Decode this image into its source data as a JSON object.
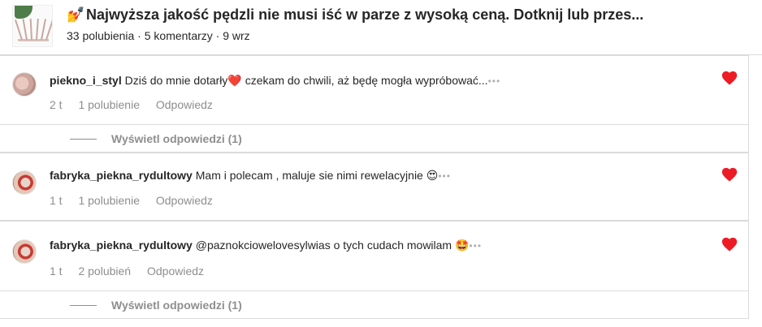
{
  "post": {
    "title": "Najwyższa jakość pędzli nie musi iść w parze z wysoką ceną. Dotknij lub przes...",
    "title_emoji": "💅",
    "meta": "33 polubienia · 5 komentarzy · 9 wrz"
  },
  "comments": [
    {
      "username": "piekno_i_styl",
      "text_before": "Dziś do mnie dotarły",
      "emoji": "❤️",
      "text_after": " czekam do chwili, aż będę mogła wypróbować...",
      "time": "2 t",
      "likes": "1 polubienie",
      "reply": "Odpowiedz",
      "more": "•••"
    },
    {
      "username": "fabryka_piekna_rydultowy",
      "text": "Mam i polecam , maluje sie nimi rewelacyjnie",
      "emoji": "😍",
      "time": "1 t",
      "likes": "1 polubienie",
      "reply": "Odpowiedz",
      "more": "•••"
    },
    {
      "username": "fabryka_piekna_rydultowy",
      "text": "@paznokciowelovesylwias o tych cudach mowilam",
      "emoji": "🤩",
      "time": "1 t",
      "likes": "2 polubień",
      "reply": "Odpowiedz",
      "more": "•••"
    }
  ],
  "replies": [
    {
      "label": "Wyświetl odpowiedzi (1)"
    },
    {
      "label": "Wyświetl odpowiedzi (1)"
    }
  ],
  "colors": {
    "heart": "#ed1c24",
    "muted": "#8e8e8e",
    "border": "#dbdbdb"
  }
}
